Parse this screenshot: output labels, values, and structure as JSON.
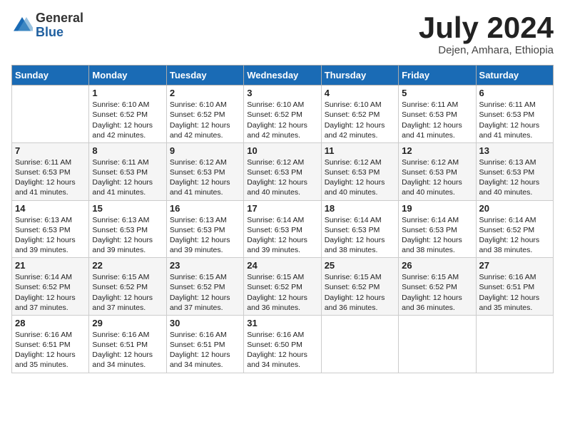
{
  "header": {
    "logo_general": "General",
    "logo_blue": "Blue",
    "month_title": "July 2024",
    "location": "Dejen, Amhara, Ethiopia"
  },
  "days_of_week": [
    "Sunday",
    "Monday",
    "Tuesday",
    "Wednesday",
    "Thursday",
    "Friday",
    "Saturday"
  ],
  "weeks": [
    [
      null,
      {
        "day": "1",
        "sunrise": "6:10 AM",
        "sunset": "6:52 PM",
        "daylight": "12 hours and 42 minutes."
      },
      {
        "day": "2",
        "sunrise": "6:10 AM",
        "sunset": "6:52 PM",
        "daylight": "12 hours and 42 minutes."
      },
      {
        "day": "3",
        "sunrise": "6:10 AM",
        "sunset": "6:52 PM",
        "daylight": "12 hours and 42 minutes."
      },
      {
        "day": "4",
        "sunrise": "6:10 AM",
        "sunset": "6:52 PM",
        "daylight": "12 hours and 42 minutes."
      },
      {
        "day": "5",
        "sunrise": "6:11 AM",
        "sunset": "6:53 PM",
        "daylight": "12 hours and 41 minutes."
      },
      {
        "day": "6",
        "sunrise": "6:11 AM",
        "sunset": "6:53 PM",
        "daylight": "12 hours and 41 minutes."
      }
    ],
    [
      {
        "day": "7",
        "sunrise": "6:11 AM",
        "sunset": "6:53 PM",
        "daylight": "12 hours and 41 minutes."
      },
      {
        "day": "8",
        "sunrise": "6:11 AM",
        "sunset": "6:53 PM",
        "daylight": "12 hours and 41 minutes."
      },
      {
        "day": "9",
        "sunrise": "6:12 AM",
        "sunset": "6:53 PM",
        "daylight": "12 hours and 41 minutes."
      },
      {
        "day": "10",
        "sunrise": "6:12 AM",
        "sunset": "6:53 PM",
        "daylight": "12 hours and 40 minutes."
      },
      {
        "day": "11",
        "sunrise": "6:12 AM",
        "sunset": "6:53 PM",
        "daylight": "12 hours and 40 minutes."
      },
      {
        "day": "12",
        "sunrise": "6:12 AM",
        "sunset": "6:53 PM",
        "daylight": "12 hours and 40 minutes."
      },
      {
        "day": "13",
        "sunrise": "6:13 AM",
        "sunset": "6:53 PM",
        "daylight": "12 hours and 40 minutes."
      }
    ],
    [
      {
        "day": "14",
        "sunrise": "6:13 AM",
        "sunset": "6:53 PM",
        "daylight": "12 hours and 39 minutes."
      },
      {
        "day": "15",
        "sunrise": "6:13 AM",
        "sunset": "6:53 PM",
        "daylight": "12 hours and 39 minutes."
      },
      {
        "day": "16",
        "sunrise": "6:13 AM",
        "sunset": "6:53 PM",
        "daylight": "12 hours and 39 minutes."
      },
      {
        "day": "17",
        "sunrise": "6:14 AM",
        "sunset": "6:53 PM",
        "daylight": "12 hours and 39 minutes."
      },
      {
        "day": "18",
        "sunrise": "6:14 AM",
        "sunset": "6:53 PM",
        "daylight": "12 hours and 38 minutes."
      },
      {
        "day": "19",
        "sunrise": "6:14 AM",
        "sunset": "6:53 PM",
        "daylight": "12 hours and 38 minutes."
      },
      {
        "day": "20",
        "sunrise": "6:14 AM",
        "sunset": "6:52 PM",
        "daylight": "12 hours and 38 minutes."
      }
    ],
    [
      {
        "day": "21",
        "sunrise": "6:14 AM",
        "sunset": "6:52 PM",
        "daylight": "12 hours and 37 minutes."
      },
      {
        "day": "22",
        "sunrise": "6:15 AM",
        "sunset": "6:52 PM",
        "daylight": "12 hours and 37 minutes."
      },
      {
        "day": "23",
        "sunrise": "6:15 AM",
        "sunset": "6:52 PM",
        "daylight": "12 hours and 37 minutes."
      },
      {
        "day": "24",
        "sunrise": "6:15 AM",
        "sunset": "6:52 PM",
        "daylight": "12 hours and 36 minutes."
      },
      {
        "day": "25",
        "sunrise": "6:15 AM",
        "sunset": "6:52 PM",
        "daylight": "12 hours and 36 minutes."
      },
      {
        "day": "26",
        "sunrise": "6:15 AM",
        "sunset": "6:52 PM",
        "daylight": "12 hours and 36 minutes."
      },
      {
        "day": "27",
        "sunrise": "6:16 AM",
        "sunset": "6:51 PM",
        "daylight": "12 hours and 35 minutes."
      }
    ],
    [
      {
        "day": "28",
        "sunrise": "6:16 AM",
        "sunset": "6:51 PM",
        "daylight": "12 hours and 35 minutes."
      },
      {
        "day": "29",
        "sunrise": "6:16 AM",
        "sunset": "6:51 PM",
        "daylight": "12 hours and 34 minutes."
      },
      {
        "day": "30",
        "sunrise": "6:16 AM",
        "sunset": "6:51 PM",
        "daylight": "12 hours and 34 minutes."
      },
      {
        "day": "31",
        "sunrise": "6:16 AM",
        "sunset": "6:50 PM",
        "daylight": "12 hours and 34 minutes."
      },
      null,
      null,
      null
    ]
  ]
}
